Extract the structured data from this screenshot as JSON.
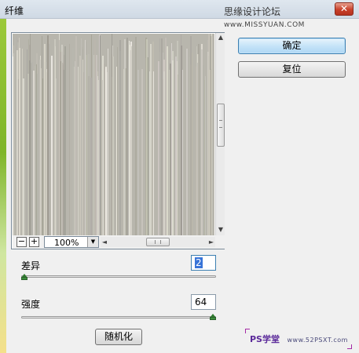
{
  "window": {
    "title": "纤维",
    "watermark": "思缘设计论坛",
    "watermark_url": "www.MISSYUAN.COM",
    "close_glyph": "✕"
  },
  "preview": {
    "zoom_out": "−",
    "zoom_in": "+",
    "zoom_value": "100%",
    "up_arrow": "▲",
    "down_arrow": "▼",
    "left_arrow": "◄",
    "right_arrow": "►",
    "dropdown_arrow": "▼"
  },
  "buttons": {
    "ok": "确定",
    "reset": "复位",
    "randomize": "随机化"
  },
  "params": {
    "variance_label": "差异",
    "variance_value": "2",
    "variance_level": 2,
    "variance_max": 64,
    "strength_label": "强度",
    "strength_value": "64",
    "strength_level": 64,
    "strength_max": 64
  },
  "branding": {
    "ps": "PS学堂",
    "url": "www.52PSXT.com"
  },
  "colors": {
    "accent": "#3c7fb1",
    "slider_knob": "#3b8f3b",
    "fiber_base": "#b8b6ad"
  }
}
